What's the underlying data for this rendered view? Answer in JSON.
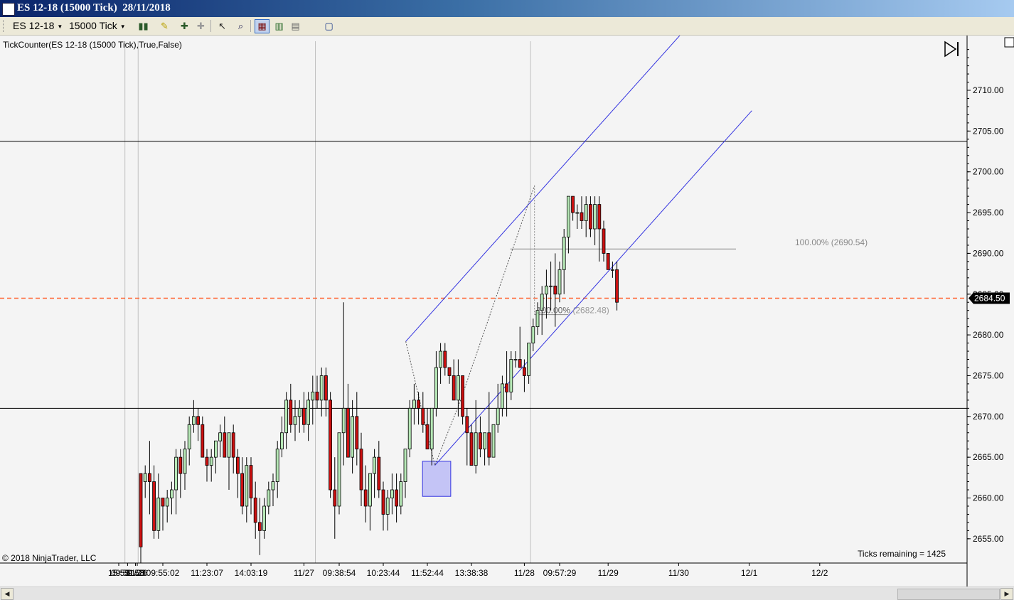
{
  "window": {
    "title": "ES 12-18 (15000 Tick)  28/11/2018"
  },
  "toolbar": {
    "instrument": "ES 12-18",
    "interval": "15000 Tick",
    "icons": [
      "bar-style-icon",
      "draw-tool-icon",
      "zoom-in-icon",
      "zoom-out-icon",
      "cursor-icon",
      "magnifier-icon",
      "chart-trader-icon",
      "data-box-icon",
      "strategies-icon",
      "properties-icon"
    ]
  },
  "indicator_label": "TickCounter(ES  12-18 (15000  Tick),True,False)",
  "copyright": "© 2018 NinjaTrader, LLC",
  "ticks_remaining": "Ticks remaining = 1425",
  "fib_labels": {
    "upper": "100.00% (2690.54)",
    "lower_pct": "100.00%",
    "lower_val": "(2682.48)"
  },
  "colors": {
    "background": "#f4f4f4",
    "up_candle": "#b6e8b6",
    "down_candle": "#cc1010",
    "wick": "#000000",
    "channel": "#3333e0",
    "zone_fill": "#c4c4f6",
    "last_price_line": "#ff6633",
    "grid_vertical": "#c0c0c0",
    "hline": "#000000"
  },
  "chart_data": {
    "type": "candlestick",
    "instrument": "ES 12-18",
    "period": "15000 Tick",
    "y_axis": {
      "ticks": [
        "2710.00",
        "2705.00",
        "2700.00",
        "2695.00",
        "2690.00",
        "2685.00",
        "2680.00",
        "2675.00",
        "2670.00",
        "2665.00",
        "2660.00",
        "2655.00"
      ],
      "tick_values": [
        2710,
        2705,
        2700,
        2695,
        2690,
        2685,
        2680,
        2675,
        2670,
        2665,
        2660,
        2655
      ],
      "range": [
        2652.8,
        2716.6
      ]
    },
    "x_axis": {
      "ticks": [
        {
          "label": "15:55",
          "index": -5
        },
        {
          "label": "09:59:58",
          "index": -3
        },
        {
          "label": "11/23",
          "index": -1.2
        },
        {
          "label": "11/26",
          "index": -0.8
        },
        {
          "label": "09:55:02",
          "index": 5
        },
        {
          "label": "11:23:07",
          "index": 15
        },
        {
          "label": "14:03:19",
          "index": 25
        },
        {
          "label": "11/27",
          "index": 37
        },
        {
          "label": "09:38:54",
          "index": 45
        },
        {
          "label": "10:23:44",
          "index": 55
        },
        {
          "label": "11:52:44",
          "index": 65
        },
        {
          "label": "13:38:38",
          "index": 75
        },
        {
          "label": "11/28",
          "index": 87
        },
        {
          "label": "09:57:29",
          "index": 95
        },
        {
          "label": "11/29",
          "index": 106
        },
        {
          "label": "11/30",
          "index": 122
        },
        {
          "label": "12/1",
          "index": 138
        },
        {
          "label": "12/2",
          "index": 154
        }
      ],
      "day_separators": [
        -3.6,
        -0.6,
        39.6,
        88.4
      ]
    },
    "price_levels": [
      2703.75,
      2671.0
    ],
    "last_price": 2684.5,
    "last_price_label": "2684.50",
    "candles": [
      [
        2663,
        2663,
        2652,
        2654
      ],
      [
        2662,
        2664,
        2660,
        2663
      ],
      [
        2663,
        2667,
        2658,
        2662
      ],
      [
        2662,
        2664,
        2655,
        2656
      ],
      [
        2656,
        2663,
        2655,
        2660
      ],
      [
        2660,
        2660,
        2656,
        2659
      ],
      [
        2659,
        2661,
        2657,
        2660
      ],
      [
        2660,
        2662,
        2658,
        2661
      ],
      [
        2661,
        2666,
        2658,
        2665
      ],
      [
        2665,
        2666,
        2660,
        2663
      ],
      [
        2663,
        2667,
        2661,
        2666
      ],
      [
        2666,
        2670,
        2664,
        2669
      ],
      [
        2669,
        2672,
        2668,
        2670
      ],
      [
        2670,
        2671,
        2667,
        2669
      ],
      [
        2669,
        2670,
        2665,
        2665
      ],
      [
        2665,
        2666,
        2662,
        2664
      ],
      [
        2664,
        2666,
        2662,
        2665
      ],
      [
        2665,
        2667,
        2663,
        2667
      ],
      [
        2667,
        2669,
        2665,
        2668
      ],
      [
        2668,
        2670,
        2665,
        2665
      ],
      [
        2665,
        2668,
        2661,
        2668
      ],
      [
        2668,
        2669,
        2663,
        2665
      ],
      [
        2665,
        2666,
        2660,
        2663
      ],
      [
        2663,
        2665,
        2658,
        2659
      ],
      [
        2659,
        2665,
        2657,
        2664
      ],
      [
        2664,
        2665,
        2658,
        2660
      ],
      [
        2660,
        2662,
        2655,
        2657
      ],
      [
        2657,
        2660,
        2653,
        2656
      ],
      [
        2656,
        2660,
        2655,
        2659
      ],
      [
        2659,
        2662,
        2658,
        2661
      ],
      [
        2661,
        2663,
        2659,
        2662
      ],
      [
        2662,
        2667,
        2660,
        2666
      ],
      [
        2666,
        2670,
        2665,
        2668
      ],
      [
        2668,
        2673,
        2666,
        2672
      ],
      [
        2672,
        2674,
        2668,
        2669
      ],
      [
        2669,
        2672,
        2667,
        2670
      ],
      [
        2670,
        2672,
        2668,
        2671
      ],
      [
        2671,
        2673,
        2668,
        2669
      ],
      [
        2669,
        2673,
        2667,
        2672
      ],
      [
        2672,
        2675,
        2669,
        2673
      ],
      [
        2673,
        2675,
        2671,
        2672
      ],
      [
        2672,
        2676,
        2670,
        2675
      ],
      [
        2675,
        2676,
        2670,
        2672
      ],
      [
        2672,
        2673,
        2660,
        2661
      ],
      [
        2661,
        2665,
        2655,
        2659
      ],
      [
        2659,
        2668,
        2658,
        2668
      ],
      [
        2668,
        2684,
        2664,
        2671
      ],
      [
        2671,
        2674,
        2665,
        2665
      ],
      [
        2665,
        2672,
        2663,
        2670
      ],
      [
        2670,
        2673,
        2664,
        2666
      ],
      [
        2666,
        2668,
        2659,
        2661
      ],
      [
        2661,
        2664,
        2657,
        2659
      ],
      [
        2659,
        2663,
        2656,
        2663
      ],
      [
        2663,
        2666,
        2660,
        2665
      ],
      [
        2665,
        2667,
        2660,
        2661
      ],
      [
        2661,
        2662,
        2656,
        2658
      ],
      [
        2658,
        2661,
        2656,
        2660
      ],
      [
        2660,
        2663,
        2658,
        2661
      ],
      [
        2661,
        2663,
        2657,
        2659
      ],
      [
        2659,
        2663,
        2658,
        2662
      ],
      [
        2662,
        2665,
        2660,
        2666
      ],
      [
        2666,
        2672,
        2665,
        2671
      ],
      [
        2671,
        2674,
        2669,
        2672
      ],
      [
        2672,
        2673,
        2669,
        2671
      ],
      [
        2671,
        2673,
        2668,
        2669
      ],
      [
        2669,
        2671,
        2666,
        2666
      ],
      [
        2666,
        2671,
        2664,
        2671
      ],
      [
        2671,
        2678,
        2670,
        2676
      ],
      [
        2676,
        2679,
        2674,
        2678
      ],
      [
        2678,
        2679,
        2675,
        2676
      ],
      [
        2676,
        2676,
        2674,
        2675
      ],
      [
        2675,
        2677,
        2672,
        2672
      ],
      [
        2672,
        2677,
        2670,
        2675
      ],
      [
        2675,
        2675,
        2669,
        2670
      ],
      [
        2670,
        2671,
        2664,
        2668
      ],
      [
        2668,
        2669,
        2664,
        2664
      ],
      [
        2664,
        2672,
        2663,
        2668
      ],
      [
        2668,
        2670,
        2665,
        2666
      ],
      [
        2666,
        2668,
        2664,
        2668
      ],
      [
        2668,
        2673,
        2664,
        2665
      ],
      [
        2665,
        2669,
        2665,
        2669
      ],
      [
        2669,
        2674,
        2668,
        2671
      ],
      [
        2671,
        2675,
        2670,
        2674
      ],
      [
        2674,
        2678,
        2670,
        2673
      ],
      [
        2673,
        2678,
        2672,
        2677
      ],
      [
        2677,
        2678,
        2676,
        2677
      ],
      [
        2677,
        2681,
        2676,
        2676
      ],
      [
        2676,
        2677,
        2673,
        2675
      ],
      [
        2675,
        2679,
        2674,
        2679
      ],
      [
        2679,
        2682,
        2678,
        2681
      ],
      [
        2681,
        2684,
        2680,
        2683
      ],
      [
        2683,
        2686,
        2680,
        2685
      ],
      [
        2685,
        2688,
        2682,
        2686
      ],
      [
        2686,
        2689,
        2683,
        2686
      ],
      [
        2686,
        2690,
        2681,
        2685
      ],
      [
        2685,
        2689,
        2684,
        2688
      ],
      [
        2688,
        2693,
        2685,
        2692
      ],
      [
        2692,
        2697,
        2690,
        2697
      ],
      [
        2697,
        2697,
        2694,
        2695
      ],
      [
        2695,
        2696,
        2693,
        2695
      ],
      [
        2695,
        2697,
        2693,
        2694
      ],
      [
        2694,
        2697,
        2692,
        2696
      ],
      [
        2696,
        2697,
        2692,
        2693
      ],
      [
        2693,
        2697,
        2691,
        2696
      ],
      [
        2696,
        2697,
        2689,
        2693
      ],
      [
        2693,
        2694,
        2689,
        2690
      ],
      [
        2690,
        2690,
        2688,
        2688
      ],
      [
        2688,
        2689,
        2687,
        2688
      ],
      [
        2688,
        2689,
        2683,
        2684
      ]
    ],
    "channel": {
      "upper": [
        [
          60.1,
          2679.2
        ],
        [
          132.0,
          2722.6
        ]
      ],
      "lower": [
        [
          66.7,
          2664.0
        ],
        [
          138.6,
          2707.5
        ]
      ]
    },
    "fibonacci": {
      "upper": {
        "level": 2690.54,
        "pct": "100.00%",
        "from_index": 83.8,
        "to_index": 135
      },
      "lower": {
        "level": 2682.48,
        "pct": "100.00%",
        "from_index": 89.3,
        "to_index": 97
      },
      "swing": [
        [
          60.1,
          2679.2
        ],
        [
          66.7,
          2664.0
        ],
        [
          72.4,
          2671.8
        ],
        [
          89.3,
          2698.3
        ]
      ]
    },
    "zone": {
      "x0": 63.9,
      "x1": 70.3,
      "y0": 2664.5,
      "y1": 2660.2
    }
  }
}
